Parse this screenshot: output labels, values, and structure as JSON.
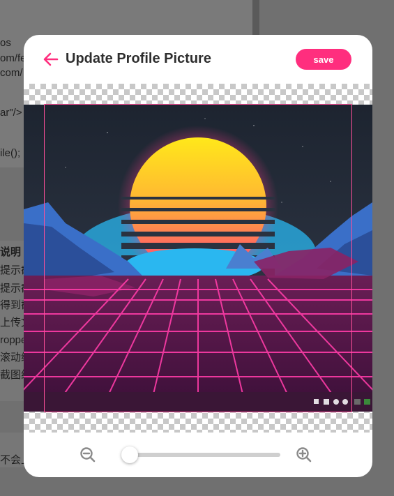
{
  "background": {
    "lines": [
      "os",
      "om/fe",
      "com/",
      "ar\"/>",
      "ile();",
      "说明",
      "提示截",
      "提示截",
      "得到截",
      "上传文",
      "roppe",
      "滚动缩",
      "截图组",
      "不会上"
    ]
  },
  "modal": {
    "title": "Update Profile Picture",
    "back_icon": "arrow-left-icon",
    "save_label": "save",
    "accent_color": "#ff2e7e"
  },
  "cropper": {
    "image": "synthwave retro sunset over neon grid",
    "frame_color": "#ff4f9a"
  },
  "zoom": {
    "zoom_out_icon": "zoom-out-icon",
    "zoom_in_icon": "zoom-in-icon",
    "level": 0.0
  }
}
